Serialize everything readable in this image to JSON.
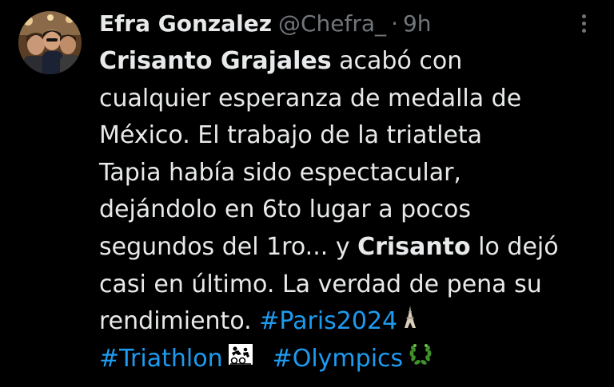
{
  "tweet": {
    "author": {
      "display_name": "Efra Gonzalez",
      "handle": "@Chefra_",
      "separator": "·",
      "time": "9h"
    },
    "more_icon": "more-horizontal-icon",
    "text": {
      "l1_bold": "Crisanto Grajales",
      "l1_rest": " acabó con",
      "l2": "cualquier esperanza de medalla de",
      "l3": "México. El trabajo de la triatleta",
      "l4": "Tapia había sido espectacular,",
      "l5": "dejándolo en 6to lugar a pocos",
      "l6_pre": "segundos del 1ro... y ",
      "l6_bold": "Crisanto",
      "l6_post": " lo dejó",
      "l7": "casi en último. La verdad de pena su",
      "l8_pre": "rendimiento. ",
      "hashtag_paris": "#Paris2024",
      "hashtag_triathlon": "#Triathlon",
      "hashtag_olympics": "#Olympics"
    },
    "emojis": [
      "eiffel-tower-emoji",
      "triathlon-pictogram-emoji",
      "olympic-laurel-emoji"
    ],
    "colors": {
      "background": "#000000",
      "text": "#e7e9ea",
      "muted": "#71767b",
      "link": "#1d9bf0"
    }
  }
}
